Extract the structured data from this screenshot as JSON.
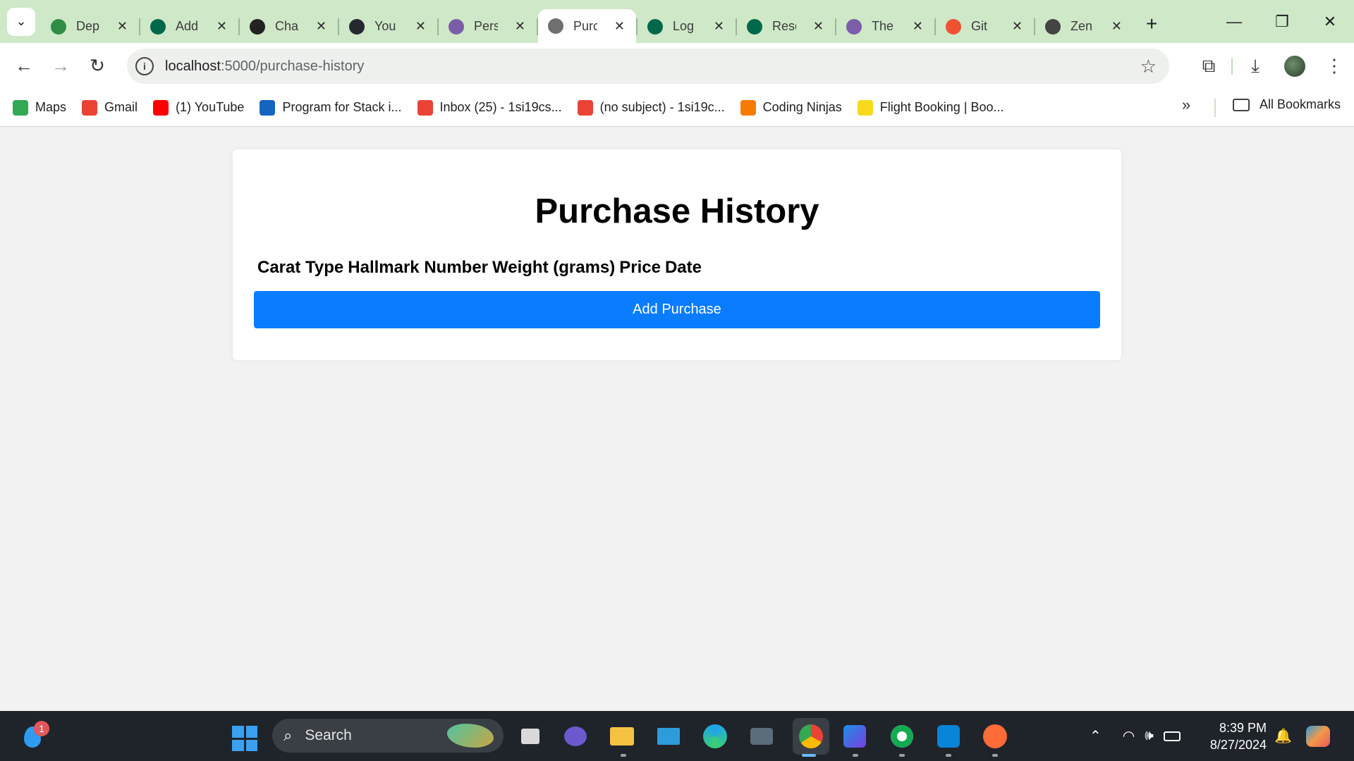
{
  "browser": {
    "tabs": [
      {
        "title": "Dep",
        "icon": "geeksforgeeks-icon",
        "color": "#2f8d46"
      },
      {
        "title": "Add",
        "icon": "mongodb-icon",
        "color": "#00684a"
      },
      {
        "title": "Cha",
        "icon": "chatgpt-icon",
        "color": "#222222"
      },
      {
        "title": "You",
        "icon": "github-icon",
        "color": "#24292f"
      },
      {
        "title": "Pers",
        "icon": "hashnode-icon",
        "color": "#7b5ea7"
      },
      {
        "title": "Purc",
        "icon": "globe-icon",
        "color": "#6f6f6f",
        "active": true
      },
      {
        "title": "Log",
        "icon": "mongodb-icon",
        "color": "#00684a"
      },
      {
        "title": "Rese",
        "icon": "mongodb-icon",
        "color": "#00684a"
      },
      {
        "title": "The",
        "icon": "hashnode-icon",
        "color": "#7b5ea7"
      },
      {
        "title": "Git",
        "icon": "git-icon",
        "color": "#f05133"
      },
      {
        "title": "Zen",
        "icon": "zen-class-icon",
        "color": "#444444"
      }
    ],
    "url_host": "localhost",
    "url_path": ":5000/purchase-history",
    "bookmarks": [
      {
        "label": "Maps",
        "icon": "google-maps-icon",
        "color": "#34a853"
      },
      {
        "label": "Gmail",
        "icon": "gmail-icon",
        "color": "#ea4335"
      },
      {
        "label": "(1) YouTube",
        "icon": "youtube-icon",
        "color": "#ff0000"
      },
      {
        "label": "Program for Stack i...",
        "icon": "geeks-grid-icon",
        "color": "#1565c0"
      },
      {
        "label": "Inbox (25) - 1si19cs...",
        "icon": "gmail-icon",
        "color": "#ea4335"
      },
      {
        "label": "(no subject) - 1si19c...",
        "icon": "gmail-icon",
        "color": "#ea4335"
      },
      {
        "label": "Coding Ninjas",
        "icon": "coding-ninjas-icon",
        "color": "#f57c00"
      },
      {
        "label": "Flight Booking | Boo...",
        "icon": "flipkart-icon",
        "color": "#f8d91c"
      }
    ],
    "all_bookmarks_label": "All Bookmarks"
  },
  "page": {
    "title": "Purchase History",
    "columns": [
      "Carat Type",
      "Hallmark Number",
      "Weight (grams)",
      "Price",
      "Date"
    ],
    "add_button_label": "Add Purchase",
    "accent_color": "#0a7cff"
  },
  "taskbar": {
    "notification_count": "1",
    "search_label": "Search",
    "time": "8:39 PM",
    "date": "8/27/2024"
  }
}
